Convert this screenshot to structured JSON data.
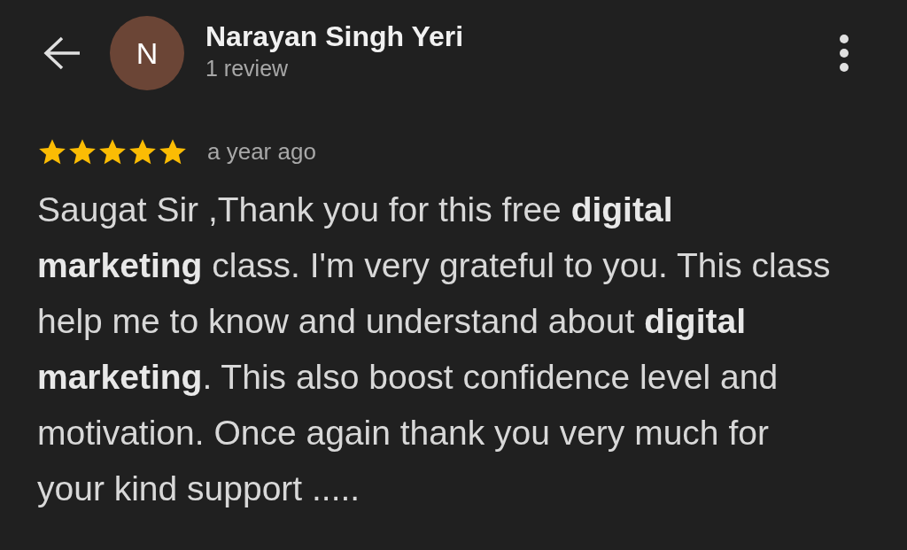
{
  "reviewer": {
    "initial": "N",
    "name": "Narayan Singh Yeri",
    "review_count": "1 review"
  },
  "review": {
    "stars": 5,
    "time": "a year ago",
    "text": "Saugat Sir ,Thank you for this free **digital marketing** class. I'm very grateful to you. This class help me to know and understand about **digital marketing**. This also boost confidence level and motivation. Once again thank you very much for your kind support ....."
  }
}
